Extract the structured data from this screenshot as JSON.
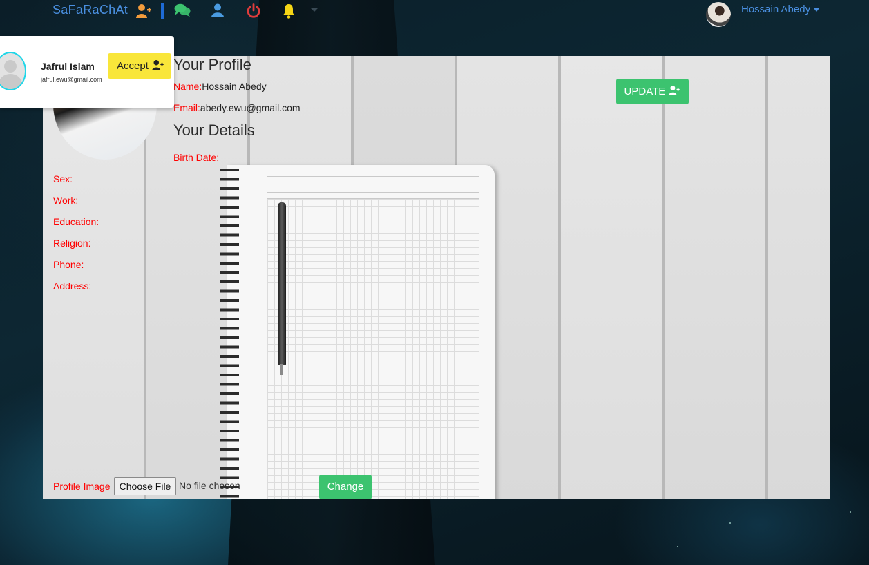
{
  "navbar": {
    "brand": "SaFaRaChAt",
    "icons": [
      {
        "name": "add-friend-icon",
        "color": "#f39c3c"
      },
      {
        "name": "chat-icon",
        "color": "#3cc36f"
      },
      {
        "name": "profile-icon",
        "color": "#4a9be0"
      },
      {
        "name": "power-icon",
        "color": "#e03c3c"
      },
      {
        "name": "bell-icon",
        "color": "#f5d515"
      }
    ],
    "user_name": "Hossain Abedy"
  },
  "notification": {
    "name": "Jafrul Islam",
    "email": "jafrul.ewu@gmail.com",
    "accept_label": "Accept"
  },
  "profile": {
    "title": "Your Profile",
    "name_label": "Name:",
    "name_value": "Hossain Abedy",
    "email_label": "Email:",
    "email_value": "abedy.ewu@gmail.com",
    "update_label": "UPDATE"
  },
  "details": {
    "title": "Your Details",
    "birth_date_label": "Birth Date:",
    "sex_label": "Sex:",
    "work_label": "Work:",
    "education_label": "Education:",
    "religion_label": "Religion:",
    "phone_label": "Phone:",
    "address_label": "Address:"
  },
  "upload": {
    "label": "Profile Image",
    "choose_label": "Choose File",
    "status": "No file chosen",
    "change_label": "Change"
  },
  "colors": {
    "label_red": "#ff0000",
    "brand_blue": "#4a8fe0",
    "button_green": "#3cc36f",
    "accept_yellow": "#f9e63a"
  }
}
